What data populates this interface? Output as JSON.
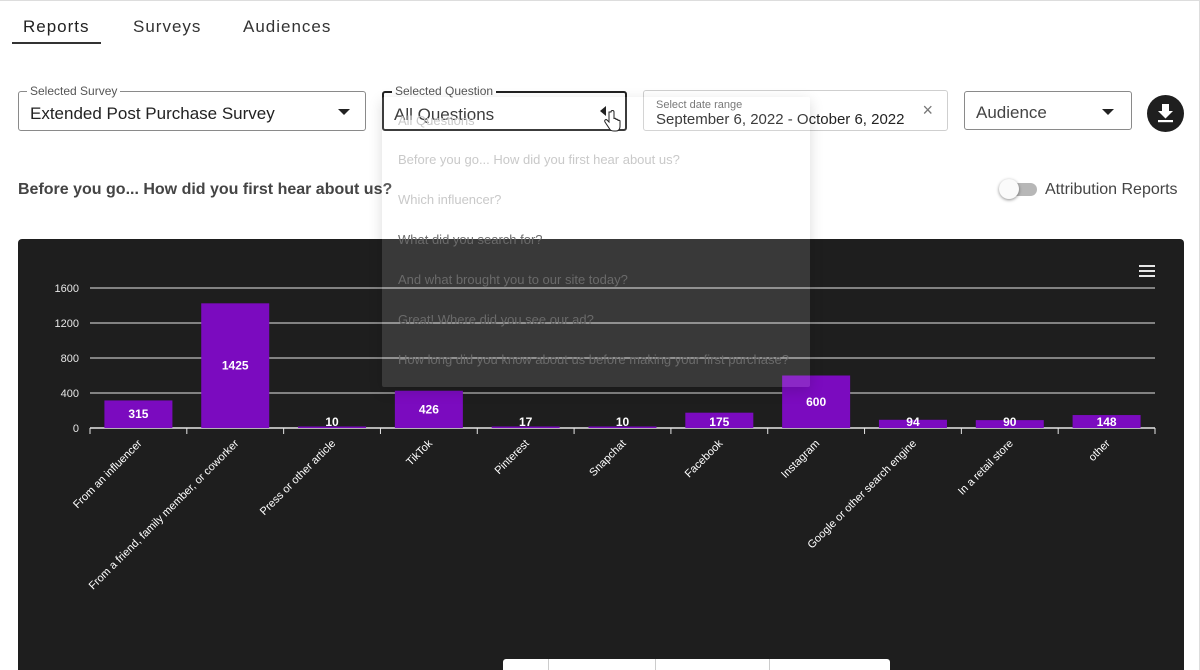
{
  "tabs": [
    {
      "label": "Reports",
      "active": true
    },
    {
      "label": "Surveys",
      "active": false
    },
    {
      "label": "Audiences",
      "active": false
    }
  ],
  "filters": {
    "survey": {
      "label": "Selected Survey",
      "value": "Extended Post Purchase Survey"
    },
    "question": {
      "label": "Selected Question",
      "value": "All Questions"
    },
    "date": {
      "label": "Select date range",
      "value": "September 6, 2022 - October 6, 2022",
      "clear_icon": "close-icon"
    },
    "audience": {
      "value": "Audience"
    },
    "download_icon": "download-icon"
  },
  "question_dropdown": {
    "items": [
      "All Questions",
      "Before you go... How did you first hear about us?",
      "Which influencer?",
      "What did you search for?",
      "And what brought you to our site today?",
      "Great! Where did you see our ad?",
      "How long did you know about us before making your first purchase?"
    ]
  },
  "question_title": "Before you go... How did you first hear about us?",
  "attribution_toggle": {
    "label": "Attribution Reports",
    "on": false
  },
  "colors": {
    "bar": "#7b0bbf",
    "chart_bg": "#1e1e1e",
    "grid": "#e6e6e6"
  },
  "chart_data": {
    "type": "bar",
    "categories": [
      "From an influencer",
      "From a friend, family member, or coworker",
      "Press or other article",
      "TikTok",
      "Pinterest",
      "Snapchat",
      "Facebook",
      "Instagram",
      "Google or other search engine",
      "In a retail store",
      "other"
    ],
    "values": [
      315,
      1425,
      10,
      426,
      17,
      10,
      175,
      600,
      94,
      90,
      148
    ],
    "yticks": [
      0,
      400,
      800,
      1200,
      1600
    ],
    "ylim": [
      0,
      1600
    ],
    "title": "",
    "xlabel": "",
    "ylabel": "",
    "grid": true
  }
}
